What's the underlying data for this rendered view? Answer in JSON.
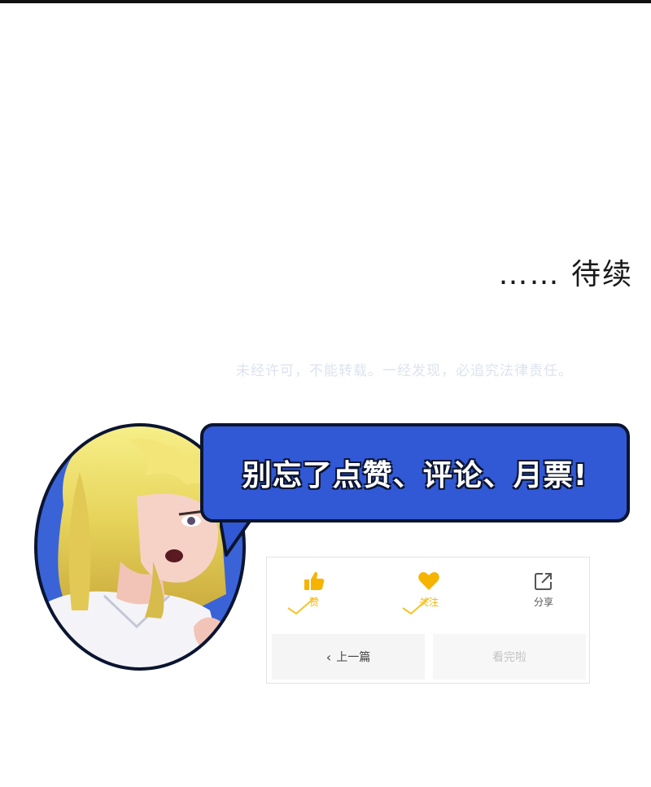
{
  "ending": {
    "to_be_continued": "…… 待续"
  },
  "copyright": {
    "notice": "未经许可，不能转载。一经发现，必追究法律责任。"
  },
  "speech_bubble": {
    "text": "别忘了点赞、评论、月票!"
  },
  "colors": {
    "bubble_blue": "#3159d6",
    "accent_yellow": "#f6b400",
    "outline": "#0b1530"
  },
  "actions": {
    "like_label": "赞",
    "like_icon": "thumbs-up-icon",
    "follow_label": "关注",
    "follow_icon": "heart-icon",
    "share_label": "分享",
    "share_icon": "share-icon"
  },
  "navigation": {
    "prev_label": "上一篇",
    "next_label": "看完啦"
  }
}
